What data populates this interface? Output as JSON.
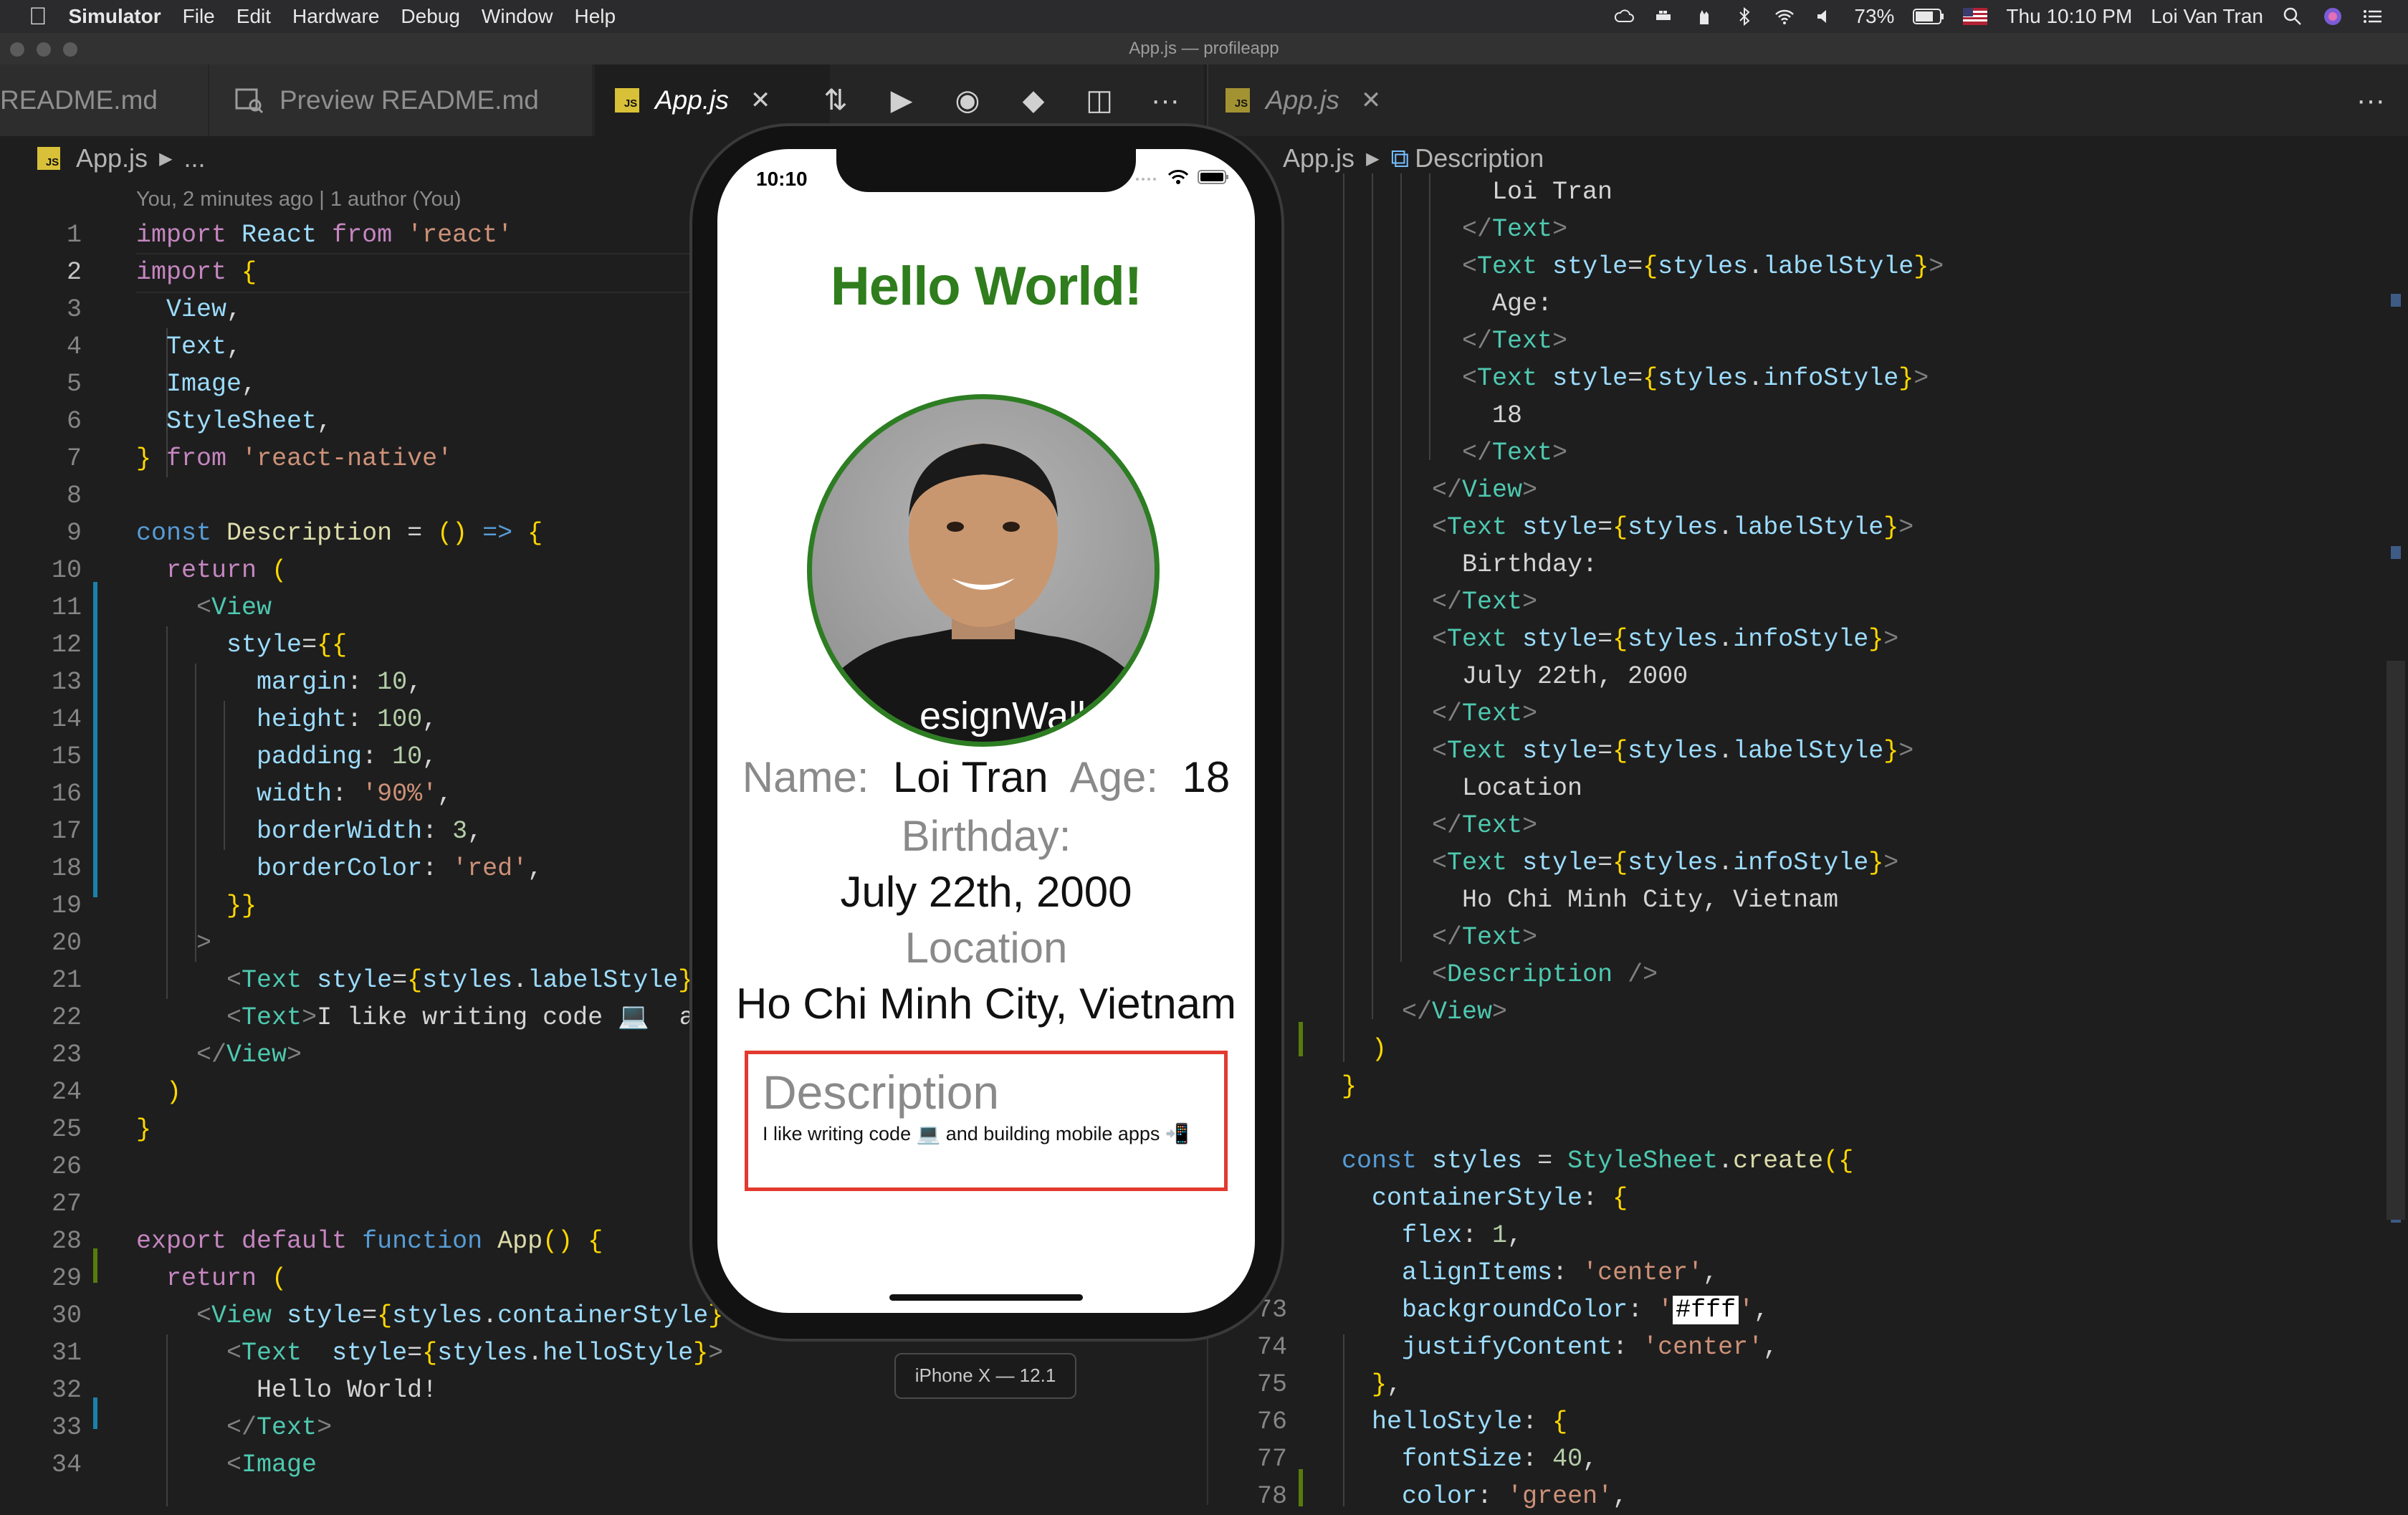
{
  "menubar": {
    "app": "Simulator",
    "items": [
      "File",
      "Edit",
      "Hardware",
      "Debug",
      "Window",
      "Help"
    ],
    "battery": "73%",
    "clock": "Thu 10:10 PM",
    "user": "Loi Van Tran"
  },
  "window": {
    "title": "App.js — profileapp"
  },
  "left_editor": {
    "tabs": [
      {
        "label": "README.md"
      },
      {
        "label": "Preview README.md"
      },
      {
        "label": "App.js"
      }
    ],
    "breadcrumb": {
      "file": "App.js",
      "rest": "..."
    },
    "blame": "You, 2 minutes ago | 1 author (You)",
    "line_numbers": [
      "1",
      "2",
      "3",
      "4",
      "5",
      "6",
      "7",
      "8",
      "9",
      "10",
      "11",
      "12",
      "13",
      "14",
      "15",
      "16",
      "17",
      "18",
      "19",
      "20",
      "21",
      "22",
      "23",
      "24",
      "25",
      "26",
      "27",
      "28",
      "29",
      "30",
      "31",
      "32",
      "33",
      "34"
    ]
  },
  "right_editor": {
    "tab": "App.js",
    "breadcrumb": {
      "file": "App.js",
      "symbol": "Description"
    },
    "line_numbers": [
      "73",
      "74",
      "75",
      "76",
      "77",
      "78"
    ]
  },
  "simulator": {
    "time": "10:10",
    "hello": "Hello World!",
    "name_label": "Name:",
    "name_value": "Loi Tran",
    "age_label": "Age:",
    "age_value": "18",
    "birthday_label": "Birthday:",
    "birthday_value": "July 22th, 2000",
    "location_label": "Location",
    "location_value": "Ho Chi Minh City, Vietnam",
    "description_title": "Description",
    "description_text": "I like writing code 💻 and building mobile apps 📲",
    "shirt_text": "esignWall",
    "device_label": "iPhone X — 12.1"
  },
  "colors": {
    "hello_green": "#2f7d1d",
    "avatar_border": "#2d7d22",
    "description_border": "#e23a2f",
    "editor_bg": "#1e1e1e"
  },
  "icons": [
    "apple-icon",
    "search-icon",
    "wifi-icon",
    "bluetooth-icon",
    "volume-icon",
    "battery-icon",
    "flag-icon",
    "siri-icon",
    "list-icon",
    "close-icon",
    "compare-icon",
    "run-icon",
    "git-icon",
    "split-editor-icon",
    "more-icon",
    "preview-icon",
    "js-file-icon",
    "chevron-right-icon",
    "symbol-icon"
  ]
}
